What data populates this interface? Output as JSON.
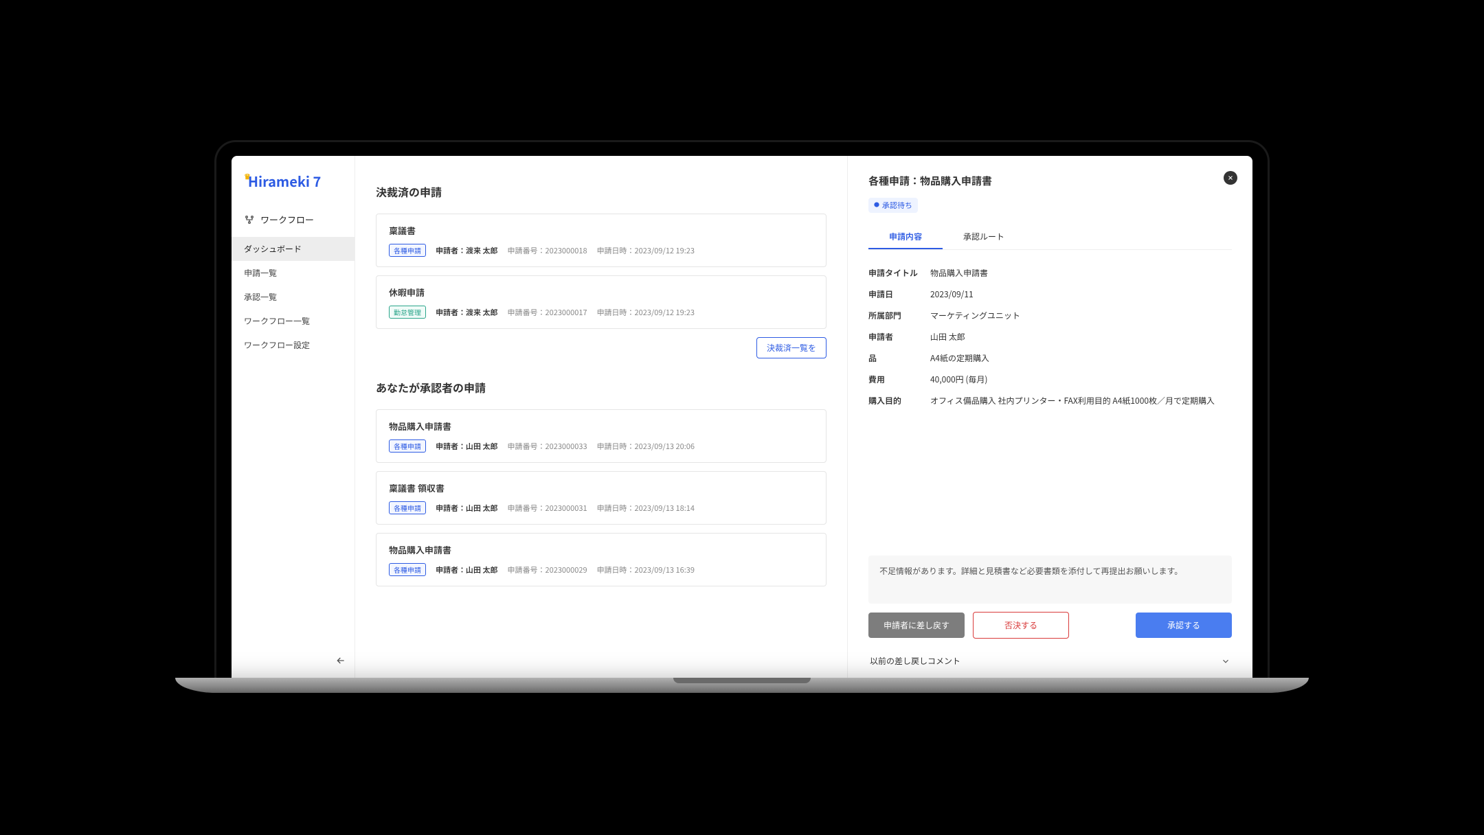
{
  "app": {
    "logo": "Hirameki 7"
  },
  "sidebar": {
    "section": "ワークフロー",
    "items": [
      {
        "label": "ダッシュボード",
        "active": true
      },
      {
        "label": "申請一覧"
      },
      {
        "label": "承認一覧"
      },
      {
        "label": "ワークフロー一覧"
      },
      {
        "label": "ワークフロー設定"
      }
    ]
  },
  "main": {
    "section1_title": "決裁済の申請",
    "section1_items": [
      {
        "title": "稟議書",
        "tag": "各種申請",
        "tag_type": "blue",
        "applicant_label": "申請者：",
        "applicant": "渡来 太郎",
        "number_label": "申請番号：",
        "number": "2023000018",
        "date_label": "申請日時：",
        "date": "2023/09/12 19:23"
      },
      {
        "title": "休暇申請",
        "tag": "勤怠管理",
        "tag_type": "teal",
        "applicant_label": "申請者：",
        "applicant": "渡来 太郎",
        "number_label": "申請番号：",
        "number": "2023000017",
        "date_label": "申請日時：",
        "date": "2023/09/12 19:23"
      }
    ],
    "view_all_label": "決裁済一覧を",
    "section2_title": "あなたが承認者の申請",
    "section2_items": [
      {
        "title": "物品購入申請書",
        "tag": "各種申請",
        "tag_type": "blue",
        "applicant_label": "申請者：",
        "applicant": "山田 太郎",
        "number_label": "申請番号：",
        "number": "2023000033",
        "date_label": "申請日時：",
        "date": "2023/09/13 20:06"
      },
      {
        "title": "稟議書 領収書",
        "tag": "各種申請",
        "tag_type": "blue",
        "applicant_label": "申請者：",
        "applicant": "山田 太郎",
        "number_label": "申請番号：",
        "number": "2023000031",
        "date_label": "申請日時：",
        "date": "2023/09/13 18:14"
      },
      {
        "title": "物品購入申請書",
        "tag": "各種申請",
        "tag_type": "blue",
        "applicant_label": "申請者：",
        "applicant": "山田 太郎",
        "number_label": "申請番号：",
        "number": "2023000029",
        "date_label": "申請日時：",
        "date": "2023/09/13 16:39"
      }
    ]
  },
  "detail": {
    "title": "各種申請：物品購入申請書",
    "status": "承認待ち",
    "tabs": [
      {
        "label": "申請内容",
        "active": true
      },
      {
        "label": "承認ルート"
      }
    ],
    "fields": [
      {
        "label": "申請タイトル",
        "value": "物品購入申請書"
      },
      {
        "label": "申請日",
        "value": "2023/09/11"
      },
      {
        "label": "所属部門",
        "value": "マーケティングユニット"
      },
      {
        "label": "申請者",
        "value": "山田 太郎"
      },
      {
        "label": "品",
        "value": "A4紙の定期購入"
      },
      {
        "label": "費用",
        "value": "40,000円 (毎月)"
      },
      {
        "label": "購入目的",
        "value": "オフィス備品購入 社内プリンター・FAX利用目的 A4紙1000枚／月で定期購入"
      }
    ],
    "comment": "不足情報があります。詳細と見積書など必要書類を添付して再提出お願いします。",
    "actions": {
      "reject": "申請者に差し戻す",
      "deny": "否決する",
      "approve": "承認する"
    },
    "prev_comments_label": "以前の差し戻しコメント"
  }
}
